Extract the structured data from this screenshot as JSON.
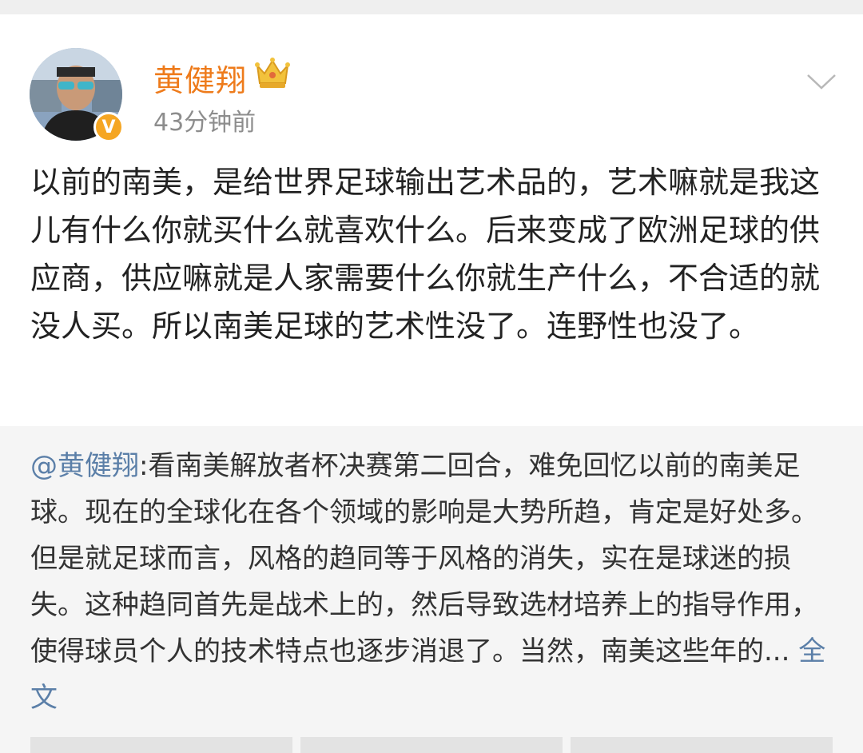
{
  "post": {
    "author": "黄健翔",
    "time": "43分钟前",
    "content": "以前的南美，是给世界足球输出艺术品的，艺术嘛就是我这儿有什么你就买什么就喜欢什么。后来变成了欧洲足球的供应商，供应嘛就是人家需要什么你就生产什么，不合适的就没人买。所以南美足球的艺术性没了。连野性也没了。",
    "icons": {
      "avatar_badge": "verified-v-icon",
      "member": "crown-icon",
      "menu": "chevron-down-icon"
    }
  },
  "repost": {
    "mention": "@黄健翔",
    "content": ":看南美解放者杯决赛第二回合，难免回忆以前的南美足球。现在的全球化在各个领域的影响是大势所趋，肯定是好处多。但是就足球而言，风格的趋同等于风格的消失，实在是球迷的损失。这种趋同首先是战术上的，然后导致选材培养上的指导作用，使得球员个人的技术特点也逐步消退了。当然，南美这些年的...",
    "full_text_link": " 全文"
  },
  "colors": {
    "username": "#ee7b1b",
    "link": "#5b7fa8",
    "repost_bg": "#f5f5f5"
  }
}
